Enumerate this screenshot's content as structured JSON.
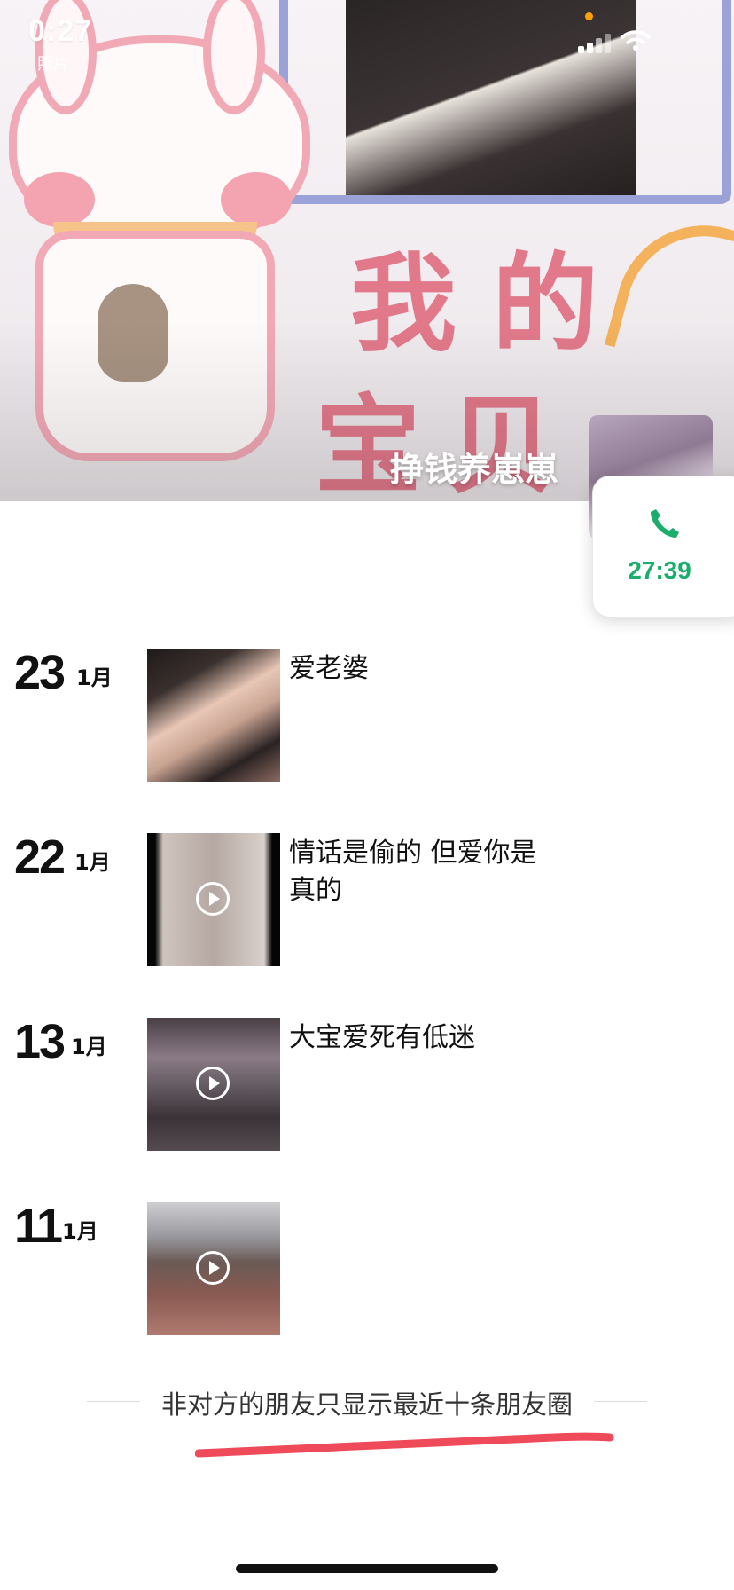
{
  "status_bar": {
    "time": "0:27",
    "sub": "照片"
  },
  "profile": {
    "name": "挣钱养崽崽"
  },
  "call": {
    "duration": "27:39"
  },
  "feed": [
    {
      "day": "23",
      "month": "1月",
      "text": "爱老婆",
      "type": "photo"
    },
    {
      "day": "22",
      "month": "1月",
      "text": "情话是偷的 但爱你是真的",
      "type": "video"
    },
    {
      "day": "13",
      "month": "1月",
      "text": "大宝爱死有低迷",
      "type": "video"
    },
    {
      "day": "11",
      "month": "1月",
      "text": "",
      "type": "video"
    }
  ],
  "notice": "非对方的朋友只显示最近十条朋友圈",
  "colors": {
    "call_green": "#1aad6b",
    "annotation_red": "#ef4a5a",
    "privacy_dot": "#ff9f0a"
  },
  "icons": {
    "signal": "signal-icon",
    "wifi": "wifi-icon",
    "phone": "phone-icon",
    "play": "play-icon"
  }
}
